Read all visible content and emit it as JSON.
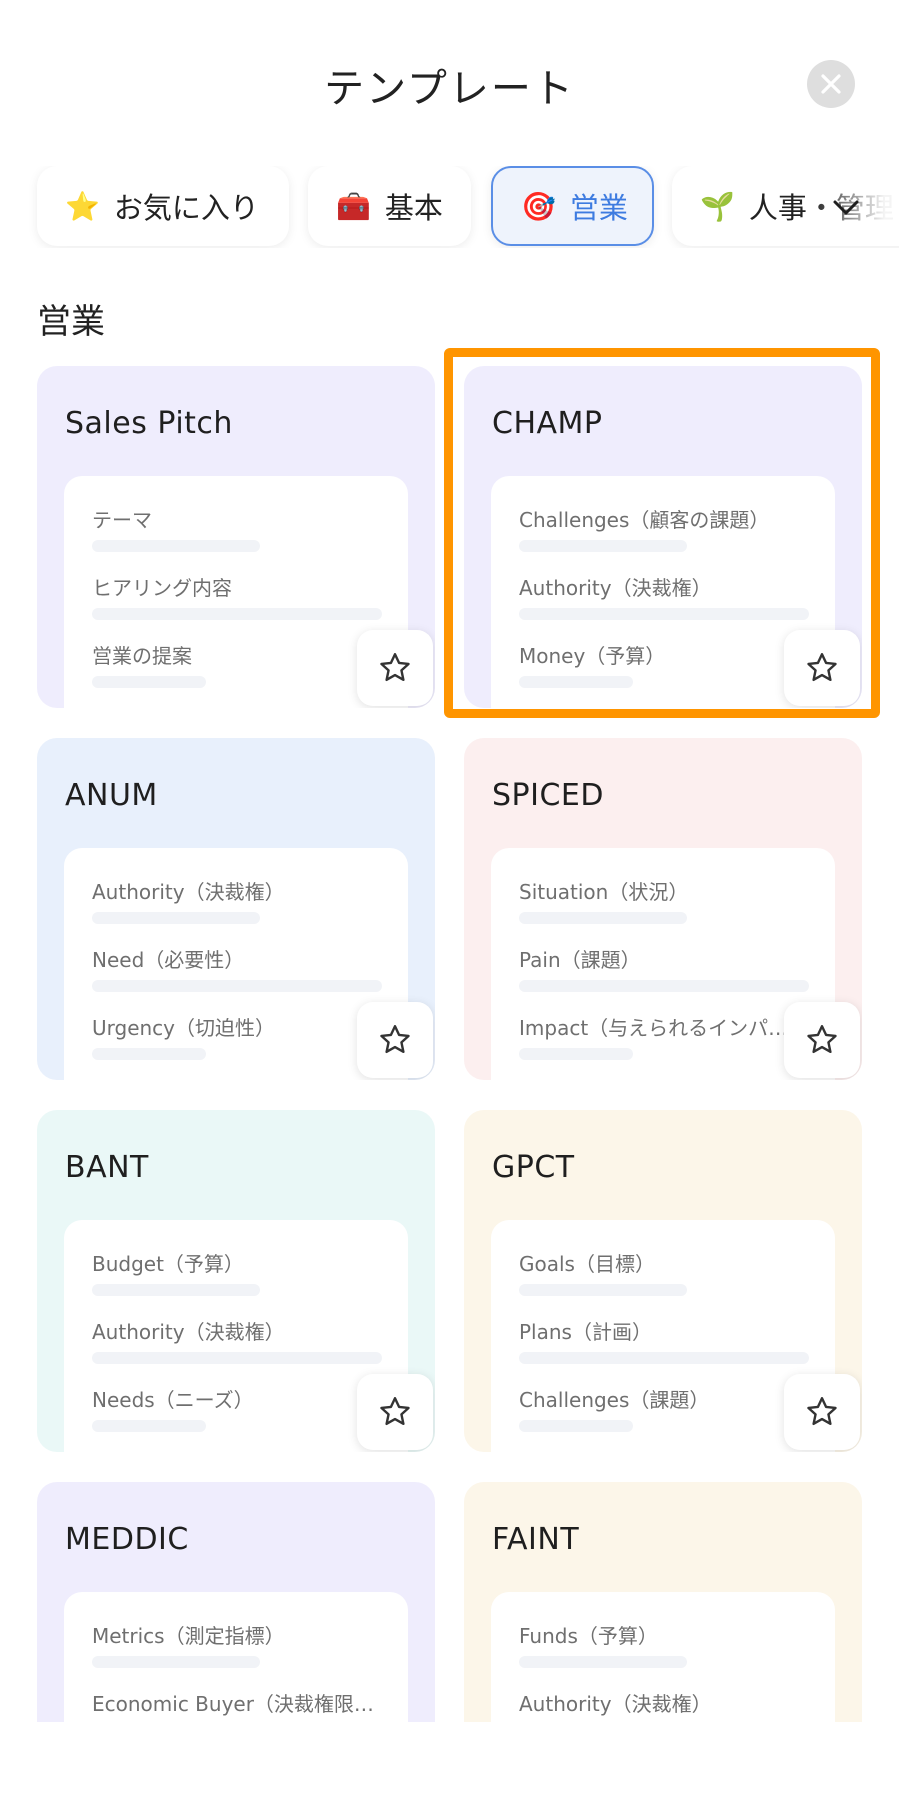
{
  "header": {
    "title": "テンプレート",
    "close_icon": "close-icon"
  },
  "tabs": [
    {
      "emoji": "⭐",
      "label": "お気に入り",
      "icon": "star-emoji-icon"
    },
    {
      "emoji": "🧰",
      "label": "基本",
      "icon": "toolbox-emoji-icon"
    },
    {
      "emoji": "🎯",
      "label": "営業",
      "icon": "target-emoji-icon",
      "active": true
    },
    {
      "emoji": "🌱",
      "label": "人事・管理",
      "icon": "seedling-emoji-icon"
    }
  ],
  "section": {
    "title": "営業"
  },
  "cards": [
    {
      "title": "Sales Pitch",
      "fields": [
        "テーマ",
        "ヒアリング内容",
        "営業の提案"
      ]
    },
    {
      "title": "CHAMP",
      "fields": [
        "Challenges（顧客の課題）",
        "Authority（決裁権）",
        "Money（予算）"
      ]
    },
    {
      "title": "ANUM",
      "fields": [
        "Authority（決裁権）",
        "Need（必要性）",
        "Urgency（切迫性）"
      ]
    },
    {
      "title": "SPICED",
      "fields": [
        "Situation（状況）",
        "Pain（課題）",
        "Impact（与えられるインパ…"
      ]
    },
    {
      "title": "BANT",
      "fields": [
        "Budget（予算）",
        "Authority（決裁権）",
        "Needs（ニーズ）"
      ]
    },
    {
      "title": "GPCT",
      "fields": [
        "Goals（目標）",
        "Plans（計画）",
        "Challenges（課題）"
      ]
    },
    {
      "title": "MEDDIC",
      "fields": [
        "Metrics（測定指標）",
        "Economic Buyer（決裁権限…"
      ]
    },
    {
      "title": "FAINT",
      "fields": [
        "Funds（予算）",
        "Authority（決裁権）"
      ]
    }
  ],
  "colors": {
    "accent": "#3d7be0",
    "highlight": "#ff9500",
    "purple": "#efedfd",
    "blue": "#e8f0fc",
    "pink": "#fcefef",
    "mint": "#eaf8f7",
    "cream": "#fcf6e9"
  }
}
